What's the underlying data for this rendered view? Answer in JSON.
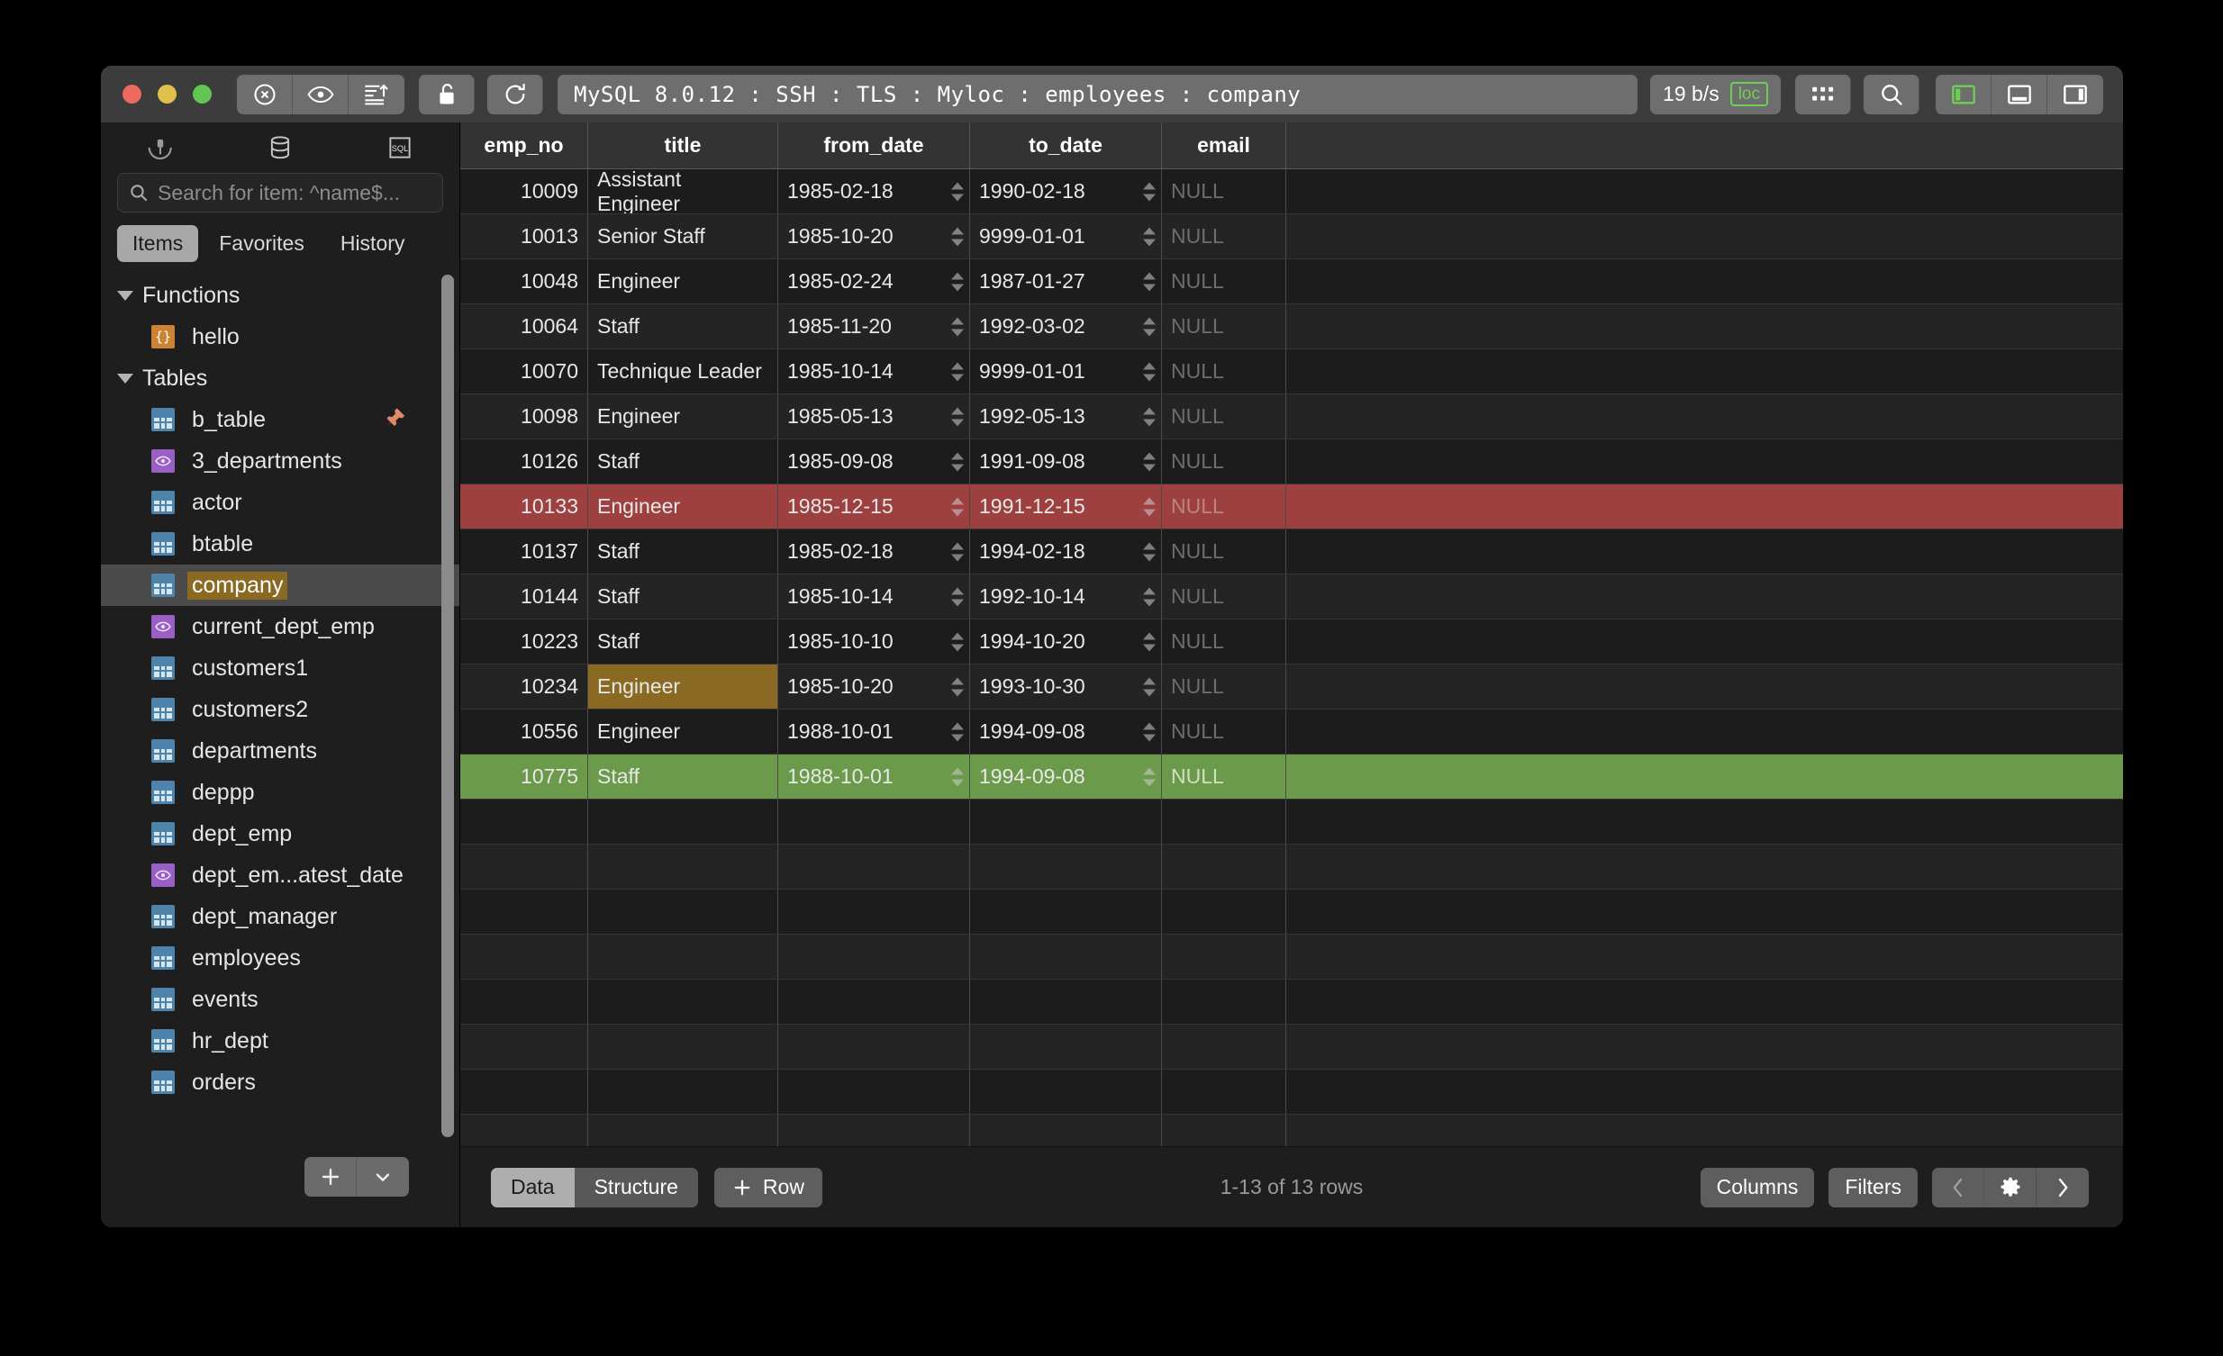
{
  "window": {
    "traffic_lights": [
      "close",
      "minimize",
      "zoom"
    ],
    "address": "MySQL 8.0.12 : SSH : TLS : Myloc : employees : company",
    "speed": "19 b/s",
    "loc_badge": "loc",
    "toolbar_icons": [
      "disconnect-icon",
      "eye-icon",
      "sort-export-icon",
      "unlock-icon",
      "refresh-icon",
      "grid-view-icon",
      "search-icon",
      "left-panel-toggle-icon",
      "bottom-panel-toggle-icon",
      "right-panel-toggle-icon"
    ]
  },
  "sidebar": {
    "top_icons": [
      "connection-icon",
      "database-icon",
      "sql-icon"
    ],
    "search": {
      "placeholder": "Search for item: ^name$...",
      "value": ""
    },
    "tabs": [
      {
        "label": "Items",
        "selected": true
      },
      {
        "label": "Favorites",
        "selected": false
      },
      {
        "label": "History",
        "selected": false
      }
    ],
    "groups": [
      {
        "label": "Functions",
        "expanded": true,
        "items": [
          {
            "label": "hello",
            "kind": "function",
            "selected": false,
            "pinned": false
          }
        ]
      },
      {
        "label": "Tables",
        "expanded": true,
        "items": [
          {
            "label": "b_table",
            "kind": "table",
            "selected": false,
            "pinned": true
          },
          {
            "label": "3_departments",
            "kind": "view",
            "selected": false,
            "pinned": false
          },
          {
            "label": "actor",
            "kind": "table",
            "selected": false,
            "pinned": false
          },
          {
            "label": "btable",
            "kind": "table",
            "selected": false,
            "pinned": false
          },
          {
            "label": "company",
            "kind": "table",
            "selected": true,
            "pinned": false
          },
          {
            "label": "current_dept_emp",
            "kind": "view",
            "selected": false,
            "pinned": false
          },
          {
            "label": "customers1",
            "kind": "table",
            "selected": false,
            "pinned": false
          },
          {
            "label": "customers2",
            "kind": "table",
            "selected": false,
            "pinned": false
          },
          {
            "label": "departments",
            "kind": "table",
            "selected": false,
            "pinned": false
          },
          {
            "label": "deppp",
            "kind": "table",
            "selected": false,
            "pinned": false
          },
          {
            "label": "dept_emp",
            "kind": "table",
            "selected": false,
            "pinned": false
          },
          {
            "label": "dept_em...atest_date",
            "kind": "view",
            "selected": false,
            "pinned": false
          },
          {
            "label": "dept_manager",
            "kind": "table",
            "selected": false,
            "pinned": false
          },
          {
            "label": "employees",
            "kind": "table",
            "selected": false,
            "pinned": false
          },
          {
            "label": "events",
            "kind": "table",
            "selected": false,
            "pinned": false
          },
          {
            "label": "hr_dept",
            "kind": "table",
            "selected": false,
            "pinned": false
          },
          {
            "label": "orders",
            "kind": "table",
            "selected": false,
            "pinned": false
          }
        ]
      }
    ],
    "add_button": "+",
    "add_menu_caret": "chevron-down-icon"
  },
  "table": {
    "columns": [
      "emp_no",
      "title",
      "from_date",
      "to_date",
      "email"
    ],
    "rows": [
      {
        "emp_no": "10009",
        "title": "Assistant Engineer",
        "from_date": "1985-02-18",
        "to_date": "1990-02-18",
        "email": "NULL",
        "highlight": "none"
      },
      {
        "emp_no": "10013",
        "title": "Senior Staff",
        "from_date": "1985-10-20",
        "to_date": "9999-01-01",
        "email": "NULL",
        "highlight": "none"
      },
      {
        "emp_no": "10048",
        "title": "Engineer",
        "from_date": "1985-02-24",
        "to_date": "1987-01-27",
        "email": "NULL",
        "highlight": "none"
      },
      {
        "emp_no": "10064",
        "title": "Staff",
        "from_date": "1985-11-20",
        "to_date": "1992-03-02",
        "email": "NULL",
        "highlight": "none"
      },
      {
        "emp_no": "10070",
        "title": "Technique Leader",
        "from_date": "1985-10-14",
        "to_date": "9999-01-01",
        "email": "NULL",
        "highlight": "none"
      },
      {
        "emp_no": "10098",
        "title": "Engineer",
        "from_date": "1985-05-13",
        "to_date": "1992-05-13",
        "email": "NULL",
        "highlight": "none"
      },
      {
        "emp_no": "10126",
        "title": "Staff",
        "from_date": "1985-09-08",
        "to_date": "1991-09-08",
        "email": "NULL",
        "highlight": "none"
      },
      {
        "emp_no": "10133",
        "title": "Engineer",
        "from_date": "1985-12-15",
        "to_date": "1991-12-15",
        "email": "NULL",
        "highlight": "red"
      },
      {
        "emp_no": "10137",
        "title": "Staff",
        "from_date": "1985-02-18",
        "to_date": "1994-02-18",
        "email": "NULL",
        "highlight": "none"
      },
      {
        "emp_no": "10144",
        "title": "Staff",
        "from_date": "1985-10-14",
        "to_date": "1992-10-14",
        "email": "NULL",
        "highlight": "none"
      },
      {
        "emp_no": "10223",
        "title": "Staff",
        "from_date": "1985-10-10",
        "to_date": "1994-10-20",
        "email": "NULL",
        "highlight": "none"
      },
      {
        "emp_no": "10234",
        "title": "Engineer",
        "from_date": "1985-10-20",
        "to_date": "1993-10-30",
        "email": "NULL",
        "highlight": "cell-title"
      },
      {
        "emp_no": "10556",
        "title": "Engineer",
        "from_date": "1988-10-01",
        "to_date": "1994-09-08",
        "email": "NULL",
        "highlight": "none"
      },
      {
        "emp_no": "10775",
        "title": "Staff",
        "from_date": "1988-10-01",
        "to_date": "1994-09-08",
        "email": "NULL",
        "highlight": "green"
      }
    ]
  },
  "bottom": {
    "view_tabs": [
      {
        "label": "Data",
        "selected": true
      },
      {
        "label": "Structure",
        "selected": false
      }
    ],
    "add_row_label": "Row",
    "row_count": "1-13 of 13 rows",
    "columns_label": "Columns",
    "filters_label": "Filters",
    "nav_icons": [
      "prev-page-icon",
      "settings-gear-icon",
      "next-page-icon"
    ]
  },
  "colors": {
    "accent_green": "#6ecf57",
    "selection_amber": "#8a6a22",
    "row_red": "#9e4040",
    "row_green": "#6a9a4a",
    "table_icon": "#4e84ab",
    "view_icon": "#9a5fc4",
    "function_icon": "#cc8434",
    "pin_icon": "#e08a6b"
  }
}
